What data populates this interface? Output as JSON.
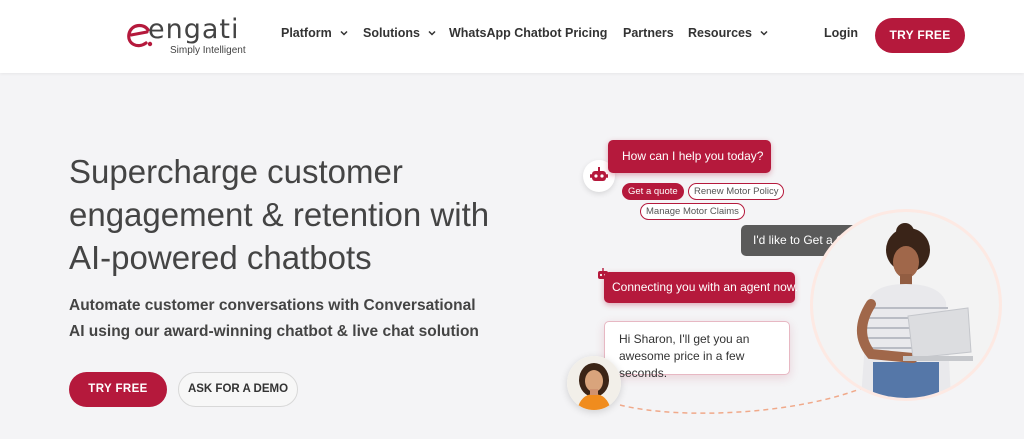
{
  "brand": {
    "name": "engati",
    "tagline": "Simply Intelligent",
    "accent": "#b5193c"
  },
  "nav": {
    "items": [
      {
        "label": "Platform",
        "dropdown": true
      },
      {
        "label": "Solutions",
        "dropdown": true
      },
      {
        "label": "WhatsApp Chatbot",
        "dropdown": false
      },
      {
        "label": "Pricing",
        "dropdown": false
      },
      {
        "label": "Partners",
        "dropdown": false
      },
      {
        "label": "Resources",
        "dropdown": true
      }
    ],
    "login": "Login",
    "cta": "TRY FREE"
  },
  "hero": {
    "title": "Supercharge customer engagement & retention with AI-powered chatbots",
    "subtitle": "Automate customer conversations with Conversational AI using our award-winning chatbot & live chat solution",
    "primary_button": "TRY FREE",
    "secondary_button": "ASK FOR A DEMO"
  },
  "chat": {
    "bot_greeting": "How can I help you today?",
    "chips": [
      "Get a quote",
      "Renew Motor Policy",
      "Manage Motor Claims"
    ],
    "user_message": "I'd like to Get a Quote.",
    "bot_connecting": "Connecting you with an agent now.",
    "agent_message": "Hi Sharon, I'll get you an awesome price in a few seconds."
  }
}
